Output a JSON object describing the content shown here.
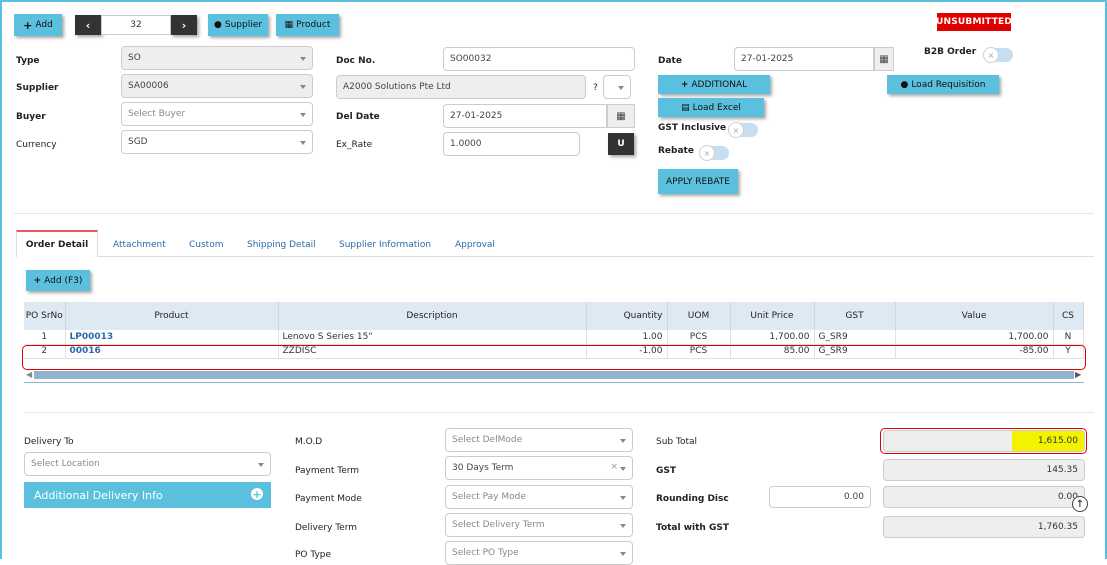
{
  "toolbar": {
    "add_label": "Add",
    "record_number": "32",
    "supplier_label": "Supplier",
    "product_label": "Product",
    "status": "UNSUBMITTED"
  },
  "header": {
    "type_label": "Type",
    "type_value": "SO",
    "supplier_label": "Supplier",
    "supplier_value": "SA00006",
    "buyer_label": "Buyer",
    "buyer_placeholder": "Select Buyer",
    "currency_label": "Currency",
    "currency_value": "SGD",
    "docno_label": "Doc No.",
    "docno_value": "SO00032",
    "supplier_name": "A2000 Solutions Pte Ltd",
    "question": "?",
    "deldate_label": "Del Date",
    "deldate_value": "27-01-2025",
    "exrate_label": "Ex_Rate",
    "exrate_value": "1.0000",
    "u_button": "U",
    "date_label": "Date",
    "date_value": "27-01-2025",
    "b2b_label": "B2B Order",
    "additional_label": "ADDITIONAL",
    "load_excel_label": "Load Excel",
    "load_requisition_label": "Load Requisition",
    "gst_inclusive_label": "GST Inclusive",
    "rebate_label": "Rebate",
    "apply_rebate_label": "APPLY REBATE"
  },
  "tabs": [
    "Order Detail",
    "Attachment",
    "Custom",
    "Shipping Detail",
    "Supplier Information",
    "Approval"
  ],
  "grid": {
    "add_label": "Add (F3)",
    "columns": [
      "PO SrNo",
      "Product",
      "Description",
      "Quantity",
      "UOM",
      "Unit Price",
      "GST",
      "Value",
      "CS"
    ],
    "rows": [
      {
        "srno": "1",
        "product": "LP00013",
        "description": "Lenovo S Series 15\"",
        "quantity": "1.00",
        "uom": "PCS",
        "unit_price": "1,700.00",
        "gst": "G_SR9",
        "value": "1,700.00",
        "cs": "N"
      },
      {
        "srno": "2",
        "product": "00016",
        "description": "ZZDISC",
        "quantity": "-1.00",
        "uom": "PCS",
        "unit_price": "85.00",
        "gst": "G_SR9",
        "value": "-85.00",
        "cs": "Y"
      }
    ]
  },
  "footer": {
    "delivery_to_label": "Delivery To",
    "location_placeholder": "Select Location",
    "additional_delivery_label": "Additional Delivery Info",
    "mod_label": "M.O.D",
    "mod_placeholder": "Select DelMode",
    "payment_term_label": "Payment Term",
    "payment_term_value": "30 Days Term",
    "payment_mode_label": "Payment Mode",
    "payment_mode_placeholder": "Select Pay Mode",
    "delivery_term_label": "Delivery Term",
    "delivery_term_placeholder": "Select Delivery Term",
    "po_type_label": "PO Type",
    "po_type_placeholder": "Select PO Type",
    "subtotal_label": "Sub Total",
    "subtotal_value": "1,615.00",
    "gst_label": "GST",
    "gst_value": "145.35",
    "rounding_label": "Rounding Disc",
    "rounding_input": "0.00",
    "rounding_value": "0.00",
    "total_label": "Total with GST",
    "total_value": "1,760.35"
  },
  "colors": {
    "accent": "#5bc0de",
    "status_red": "#e00000",
    "highlight_yellow": "#f3f300",
    "link_blue": "#2a6aa8"
  }
}
